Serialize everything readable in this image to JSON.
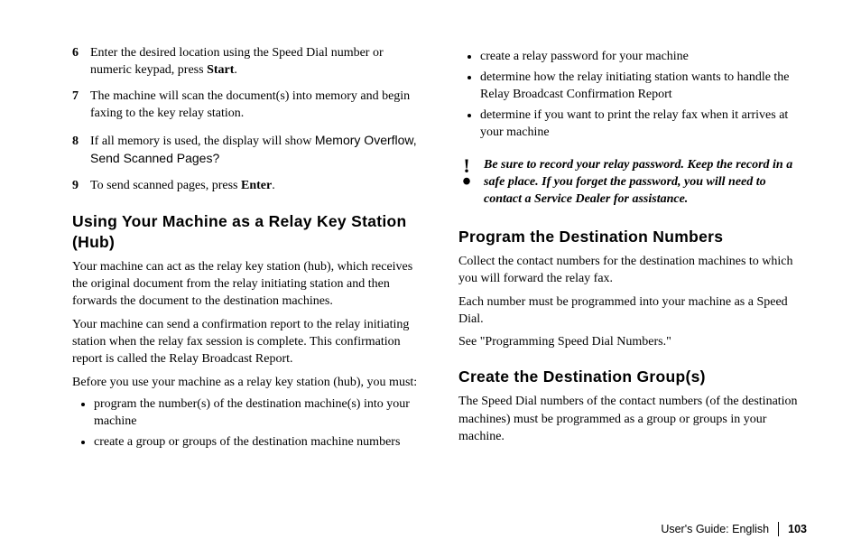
{
  "left": {
    "steps": [
      {
        "num": "6",
        "parts": [
          "Enter the desired location using the Speed Dial number or numeric keypad, press ",
          {
            "b": "Start"
          },
          "."
        ]
      },
      {
        "num": "7",
        "parts": [
          "The machine will scan the document(s) into memory and begin faxing to the key relay station."
        ]
      },
      {
        "num": "8",
        "parts": [
          "If all memory is used, the display will show ",
          {
            "ui": "Memory Overflow, Send Scanned Pages?"
          }
        ]
      },
      {
        "num": "9",
        "parts": [
          "To send scanned pages, press ",
          {
            "b": "Enter"
          },
          "."
        ]
      }
    ],
    "heading": "Using Your Machine as a Relay Key Station (Hub)",
    "paras": [
      "Your machine can act as the relay key station (hub), which receives the original document from the relay initiating station and then forwards the document to the destination machines.",
      "Your machine can send a confirmation report to the relay initiating station when the relay fax session is complete. This confirmation report is called the Relay Broadcast Report.",
      "Before you use your machine as a relay key station (hub), you must:"
    ],
    "bullets": [
      "program the number(s) of the destination machine(s) into your machine",
      "create a group or groups of the destination machine numbers"
    ]
  },
  "right": {
    "top_bullets": [
      "create a relay password for your machine",
      "determine how the relay initiating station wants to handle the Relay Broadcast Confirmation Report",
      "determine if you want to print the relay fax when it arrives at your machine"
    ],
    "note": "Be sure to record your relay password.  Keep the record in a safe place.  If you forget the password, you will need to contact a Service Dealer for assistance.",
    "h_program": "Program the Destination Numbers",
    "program_paras": [
      "Collect the contact numbers for the destination machines to which you will forward the relay fax.",
      "Each number must be programmed into your machine as a Speed Dial.",
      "See \"Programming Speed Dial Numbers.\""
    ],
    "h_create": "Create the Destination Group(s)",
    "create_paras": [
      "The Speed Dial numbers of the contact numbers (of the destination machines) must be programmed as a group or groups in your machine."
    ]
  },
  "footer": {
    "label": "User's Guide:  English",
    "page": "103"
  }
}
